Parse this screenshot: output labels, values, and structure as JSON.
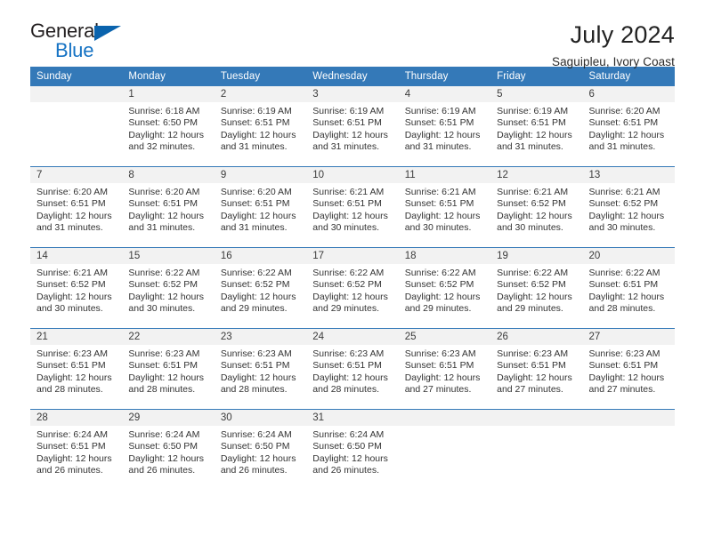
{
  "brand": {
    "name_part1": "General",
    "name_part2": "Blue",
    "accent_color": "#1673c4",
    "triangle_color": "#0a63ad"
  },
  "header": {
    "title": "July 2024",
    "subtitle": "Saguipleu, Ivory Coast"
  },
  "calendar": {
    "header_bg": "#3479b8",
    "header_text_color": "#ffffff",
    "daynum_bg": "#f2f2f2",
    "weekdays": [
      "Sunday",
      "Monday",
      "Tuesday",
      "Wednesday",
      "Thursday",
      "Friday",
      "Saturday"
    ],
    "weeks": [
      [
        {
          "day": "",
          "lines": []
        },
        {
          "day": "1",
          "lines": [
            "Sunrise: 6:18 AM",
            "Sunset: 6:50 PM",
            "Daylight: 12 hours",
            "and 32 minutes."
          ]
        },
        {
          "day": "2",
          "lines": [
            "Sunrise: 6:19 AM",
            "Sunset: 6:51 PM",
            "Daylight: 12 hours",
            "and 31 minutes."
          ]
        },
        {
          "day": "3",
          "lines": [
            "Sunrise: 6:19 AM",
            "Sunset: 6:51 PM",
            "Daylight: 12 hours",
            "and 31 minutes."
          ]
        },
        {
          "day": "4",
          "lines": [
            "Sunrise: 6:19 AM",
            "Sunset: 6:51 PM",
            "Daylight: 12 hours",
            "and 31 minutes."
          ]
        },
        {
          "day": "5",
          "lines": [
            "Sunrise: 6:19 AM",
            "Sunset: 6:51 PM",
            "Daylight: 12 hours",
            "and 31 minutes."
          ]
        },
        {
          "day": "6",
          "lines": [
            "Sunrise: 6:20 AM",
            "Sunset: 6:51 PM",
            "Daylight: 12 hours",
            "and 31 minutes."
          ]
        }
      ],
      [
        {
          "day": "7",
          "lines": [
            "Sunrise: 6:20 AM",
            "Sunset: 6:51 PM",
            "Daylight: 12 hours",
            "and 31 minutes."
          ]
        },
        {
          "day": "8",
          "lines": [
            "Sunrise: 6:20 AM",
            "Sunset: 6:51 PM",
            "Daylight: 12 hours",
            "and 31 minutes."
          ]
        },
        {
          "day": "9",
          "lines": [
            "Sunrise: 6:20 AM",
            "Sunset: 6:51 PM",
            "Daylight: 12 hours",
            "and 31 minutes."
          ]
        },
        {
          "day": "10",
          "lines": [
            "Sunrise: 6:21 AM",
            "Sunset: 6:51 PM",
            "Daylight: 12 hours",
            "and 30 minutes."
          ]
        },
        {
          "day": "11",
          "lines": [
            "Sunrise: 6:21 AM",
            "Sunset: 6:51 PM",
            "Daylight: 12 hours",
            "and 30 minutes."
          ]
        },
        {
          "day": "12",
          "lines": [
            "Sunrise: 6:21 AM",
            "Sunset: 6:52 PM",
            "Daylight: 12 hours",
            "and 30 minutes."
          ]
        },
        {
          "day": "13",
          "lines": [
            "Sunrise: 6:21 AM",
            "Sunset: 6:52 PM",
            "Daylight: 12 hours",
            "and 30 minutes."
          ]
        }
      ],
      [
        {
          "day": "14",
          "lines": [
            "Sunrise: 6:21 AM",
            "Sunset: 6:52 PM",
            "Daylight: 12 hours",
            "and 30 minutes."
          ]
        },
        {
          "day": "15",
          "lines": [
            "Sunrise: 6:22 AM",
            "Sunset: 6:52 PM",
            "Daylight: 12 hours",
            "and 30 minutes."
          ]
        },
        {
          "day": "16",
          "lines": [
            "Sunrise: 6:22 AM",
            "Sunset: 6:52 PM",
            "Daylight: 12 hours",
            "and 29 minutes."
          ]
        },
        {
          "day": "17",
          "lines": [
            "Sunrise: 6:22 AM",
            "Sunset: 6:52 PM",
            "Daylight: 12 hours",
            "and 29 minutes."
          ]
        },
        {
          "day": "18",
          "lines": [
            "Sunrise: 6:22 AM",
            "Sunset: 6:52 PM",
            "Daylight: 12 hours",
            "and 29 minutes."
          ]
        },
        {
          "day": "19",
          "lines": [
            "Sunrise: 6:22 AM",
            "Sunset: 6:52 PM",
            "Daylight: 12 hours",
            "and 29 minutes."
          ]
        },
        {
          "day": "20",
          "lines": [
            "Sunrise: 6:22 AM",
            "Sunset: 6:51 PM",
            "Daylight: 12 hours",
            "and 28 minutes."
          ]
        }
      ],
      [
        {
          "day": "21",
          "lines": [
            "Sunrise: 6:23 AM",
            "Sunset: 6:51 PM",
            "Daylight: 12 hours",
            "and 28 minutes."
          ]
        },
        {
          "day": "22",
          "lines": [
            "Sunrise: 6:23 AM",
            "Sunset: 6:51 PM",
            "Daylight: 12 hours",
            "and 28 minutes."
          ]
        },
        {
          "day": "23",
          "lines": [
            "Sunrise: 6:23 AM",
            "Sunset: 6:51 PM",
            "Daylight: 12 hours",
            "and 28 minutes."
          ]
        },
        {
          "day": "24",
          "lines": [
            "Sunrise: 6:23 AM",
            "Sunset: 6:51 PM",
            "Daylight: 12 hours",
            "and 28 minutes."
          ]
        },
        {
          "day": "25",
          "lines": [
            "Sunrise: 6:23 AM",
            "Sunset: 6:51 PM",
            "Daylight: 12 hours",
            "and 27 minutes."
          ]
        },
        {
          "day": "26",
          "lines": [
            "Sunrise: 6:23 AM",
            "Sunset: 6:51 PM",
            "Daylight: 12 hours",
            "and 27 minutes."
          ]
        },
        {
          "day": "27",
          "lines": [
            "Sunrise: 6:23 AM",
            "Sunset: 6:51 PM",
            "Daylight: 12 hours",
            "and 27 minutes."
          ]
        }
      ],
      [
        {
          "day": "28",
          "lines": [
            "Sunrise: 6:24 AM",
            "Sunset: 6:51 PM",
            "Daylight: 12 hours",
            "and 26 minutes."
          ]
        },
        {
          "day": "29",
          "lines": [
            "Sunrise: 6:24 AM",
            "Sunset: 6:50 PM",
            "Daylight: 12 hours",
            "and 26 minutes."
          ]
        },
        {
          "day": "30",
          "lines": [
            "Sunrise: 6:24 AM",
            "Sunset: 6:50 PM",
            "Daylight: 12 hours",
            "and 26 minutes."
          ]
        },
        {
          "day": "31",
          "lines": [
            "Sunrise: 6:24 AM",
            "Sunset: 6:50 PM",
            "Daylight: 12 hours",
            "and 26 minutes."
          ]
        },
        {
          "day": "",
          "lines": []
        },
        {
          "day": "",
          "lines": []
        },
        {
          "day": "",
          "lines": []
        }
      ]
    ]
  }
}
